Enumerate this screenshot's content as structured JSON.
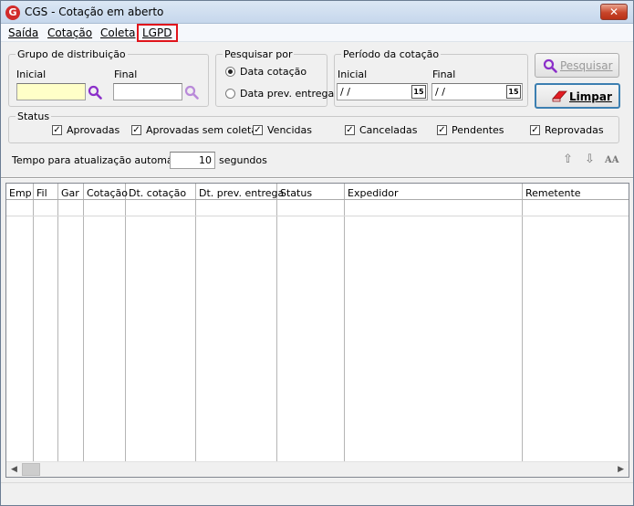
{
  "window": {
    "title": "CGS - Cotação em aberto",
    "icon_letter": "G",
    "close_symbol": "✕"
  },
  "menu": {
    "items": [
      "Saída",
      "Cotação",
      "Coleta",
      "LGPD"
    ]
  },
  "grupo": {
    "legend": "Grupo de distribuição",
    "inicial_label": "Inicial",
    "final_label": "Final",
    "inicial_value": "",
    "final_value": ""
  },
  "pesquisar_por": {
    "legend": "Pesquisar por",
    "options": [
      "Data cotação",
      "Data prev. entrega"
    ],
    "selected": "Data cotação"
  },
  "periodo": {
    "legend": "Período da cotação",
    "inicial_label": "Inicial",
    "final_label": "Final",
    "inicial_value": "/ /",
    "final_value": "/ /",
    "calendar_label": "15"
  },
  "buttons": {
    "pesquisar": "Pesquisar",
    "limpar": "Limpar"
  },
  "status": {
    "legend": "Status",
    "items": [
      {
        "label": "Aprovadas",
        "checked": true
      },
      {
        "label": "Aprovadas sem coleta",
        "checked": true
      },
      {
        "label": "Vencidas",
        "checked": true
      },
      {
        "label": "Canceladas",
        "checked": true
      },
      {
        "label": "Pendentes",
        "checked": true
      },
      {
        "label": "Reprovadas",
        "checked": true
      }
    ]
  },
  "refresh": {
    "label": "Tempo para atualização automática",
    "value": "10",
    "unit": "segundos"
  },
  "toolbar_icons": [
    "arrow-up-icon",
    "arrow-down-icon",
    "font-size-icon"
  ],
  "font_icon_text": "AA",
  "grid": {
    "columns": [
      "Emp",
      "Fil",
      "Gar",
      "Cotação",
      "Dt. cotação",
      "Dt. prev. entrega",
      "Status",
      "Expedidor",
      "Remetente"
    ],
    "rows": []
  },
  "colors": {
    "highlight": "#e0141b",
    "input_yellow": "#ffffc8",
    "search_purple": "#8b2fc9"
  }
}
